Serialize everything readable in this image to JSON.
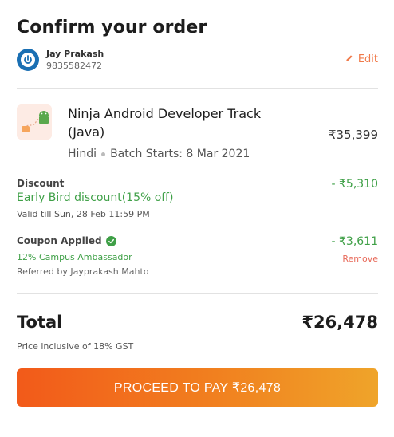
{
  "header": {
    "title": "Confirm your order"
  },
  "user": {
    "name": "Jay Prakash",
    "phone": "9835582472",
    "edit_label": "Edit",
    "avatar_icon": "power-icon"
  },
  "course": {
    "name": "Ninja Android Developer Track (Java)",
    "price": "₹35,399",
    "language": "Hindi",
    "batch": "Batch Starts: 8 Mar 2021",
    "thumbnail_icon": "android-course-icon"
  },
  "discount": {
    "label": "Discount",
    "name": "Early Bird discount(15% off)",
    "valid": "Valid till Sun, 28 Feb 11:59 PM",
    "amount": "- ₹5,310"
  },
  "coupon": {
    "label": "Coupon Applied",
    "name": "12% Campus Ambassador",
    "referred": "Referred by Jayprakash Mahto",
    "amount": "- ₹3,611",
    "remove_label": "Remove"
  },
  "total": {
    "label": "Total",
    "amount": "₹26,478",
    "gst_note": "Price inclusive of 18% GST"
  },
  "cta": {
    "label": "PROCEED TO PAY ₹26,478"
  },
  "colors": {
    "accent_orange": "#f25a1a",
    "discount_green": "#3fa047",
    "remove_red": "#e86a5a",
    "edit_orange": "#f07a4a"
  }
}
